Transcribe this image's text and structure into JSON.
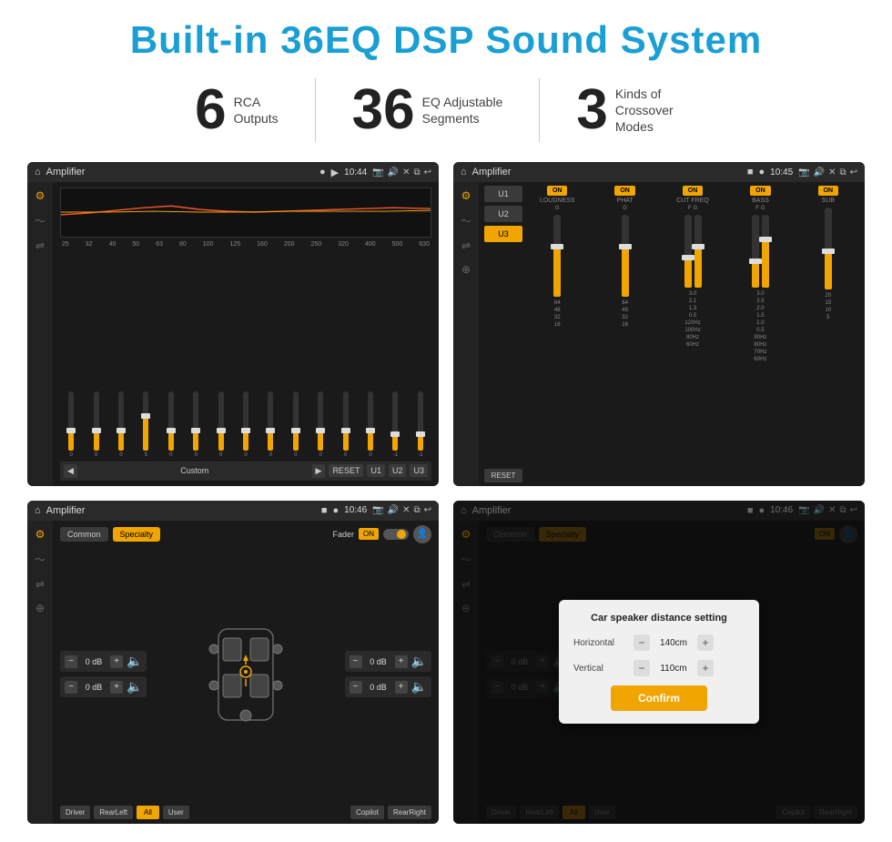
{
  "page": {
    "title": "Built-in 36EQ DSP Sound System",
    "stats": [
      {
        "number": "6",
        "label": "RCA\nOutputs"
      },
      {
        "number": "36",
        "label": "EQ Adjustable\nSegments"
      },
      {
        "number": "3",
        "label": "Kinds of\nCrossover Modes"
      }
    ]
  },
  "screen1": {
    "topbar": {
      "title": "Amplifier",
      "time": "10:44"
    },
    "freqs": [
      "25",
      "32",
      "40",
      "50",
      "63",
      "80",
      "100",
      "125",
      "160",
      "200",
      "250",
      "320",
      "400",
      "500",
      "630"
    ],
    "sliderVals": [
      "0",
      "0",
      "0",
      "5",
      "0",
      "0",
      "0",
      "0",
      "0",
      "0",
      "0",
      "0",
      "0",
      "-1",
      "-1"
    ],
    "bottomBtns": [
      "Custom",
      "RESET",
      "U1",
      "U2",
      "U3"
    ]
  },
  "screen2": {
    "topbar": {
      "title": "Amplifier",
      "time": "10:45"
    },
    "presets": [
      "U1",
      "U2",
      "U3"
    ],
    "channels": [
      {
        "label": "LOUDNESS",
        "on": true,
        "g": ""
      },
      {
        "label": "PHAT",
        "on": true,
        "g": ""
      },
      {
        "label": "CUT FREQ",
        "on": true,
        "f": "",
        "g": ""
      },
      {
        "label": "BASS",
        "on": true,
        "f": "",
        "g": ""
      },
      {
        "label": "SUB",
        "on": true
      }
    ]
  },
  "screen3": {
    "topbar": {
      "title": "Amplifier",
      "time": "10:46"
    },
    "tabs": [
      "Common",
      "Specialty"
    ],
    "fader": "Fader",
    "faderOn": "ON",
    "controls": [
      {
        "value": "0 dB"
      },
      {
        "value": "0 dB"
      },
      {
        "value": "0 dB"
      },
      {
        "value": "0 dB"
      }
    ],
    "bottomBtns": [
      "Driver",
      "RearLeft",
      "All",
      "User",
      "Copilot",
      "RearRight"
    ]
  },
  "screen4": {
    "topbar": {
      "title": "Amplifier",
      "time": "10:46"
    },
    "tabs": [
      "Common",
      "Specialty"
    ],
    "faderOn": "ON",
    "dialog": {
      "title": "Car speaker distance setting",
      "rows": [
        {
          "label": "Horizontal",
          "value": "140cm"
        },
        {
          "label": "Vertical",
          "value": "110cm"
        }
      ],
      "confirmLabel": "Confirm"
    },
    "controls": [
      {
        "value": "0 dB"
      },
      {
        "value": "0 dB"
      }
    ],
    "bottomBtns": [
      "Driver",
      "RearLeft",
      "All",
      "User",
      "Copilot",
      "RearRight"
    ]
  }
}
